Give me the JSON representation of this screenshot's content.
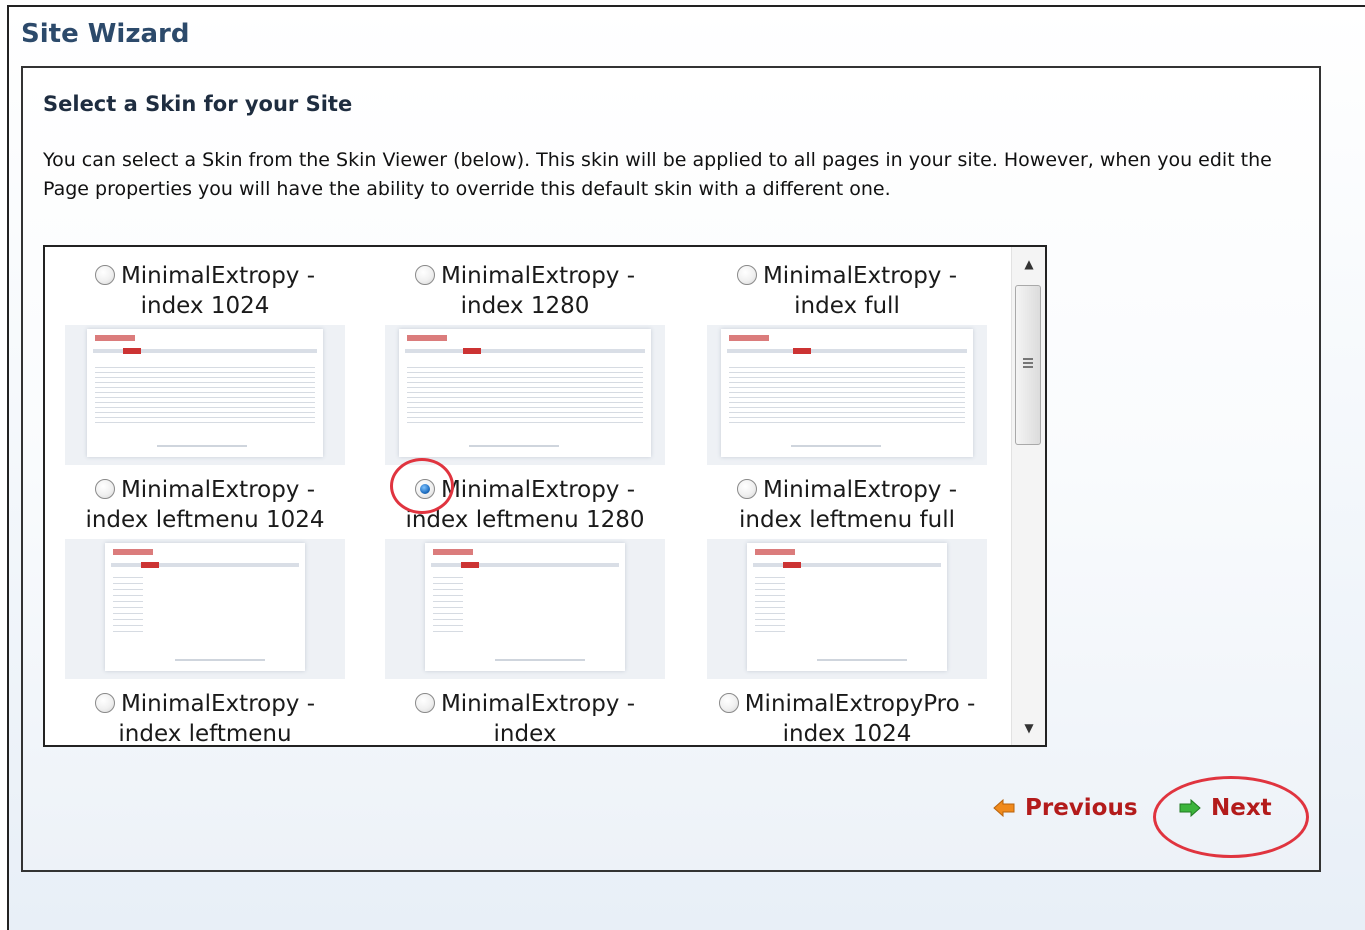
{
  "wizard": {
    "title": "Site Wizard"
  },
  "section": {
    "heading": "Select a Skin for your Site",
    "description": "You can select a Skin from the Skin Viewer (below). This skin will be applied to all pages in your site. However, when you edit the Page properties you will have the ability to override this default skin with a different one."
  },
  "skins": [
    {
      "line1": "MinimalExtropy -",
      "line2": "index 1024",
      "selected": false
    },
    {
      "line1": "MinimalExtropy -",
      "line2": "index 1280",
      "selected": false
    },
    {
      "line1": "MinimalExtropy -",
      "line2": "index full",
      "selected": false
    },
    {
      "line1": "MinimalExtropy -",
      "line2": "index leftmenu 1024",
      "selected": false
    },
    {
      "line1": "MinimalExtropy -",
      "line2": "index leftmenu 1280",
      "selected": true
    },
    {
      "line1": "MinimalExtropy -",
      "line2": "index leftmenu full",
      "selected": false
    },
    {
      "line1": "MinimalExtropy -",
      "line2": "index leftmenu",
      "selected": false
    },
    {
      "line1": "MinimalExtropy -",
      "line2": "index",
      "selected": false
    },
    {
      "line1": "MinimalExtropyPro -",
      "line2": "index 1024",
      "selected": false
    }
  ],
  "navigation": {
    "previous_label": "Previous",
    "next_label": "Next"
  },
  "icons": {
    "previous": "arrow-left-icon",
    "next": "arrow-right-icon"
  },
  "colors": {
    "title": "#2c4a6b",
    "nav_text": "#b31b1b",
    "highlight": "#e0343f",
    "prev_arrow": "#f08a1c",
    "next_arrow": "#3cb43c"
  }
}
